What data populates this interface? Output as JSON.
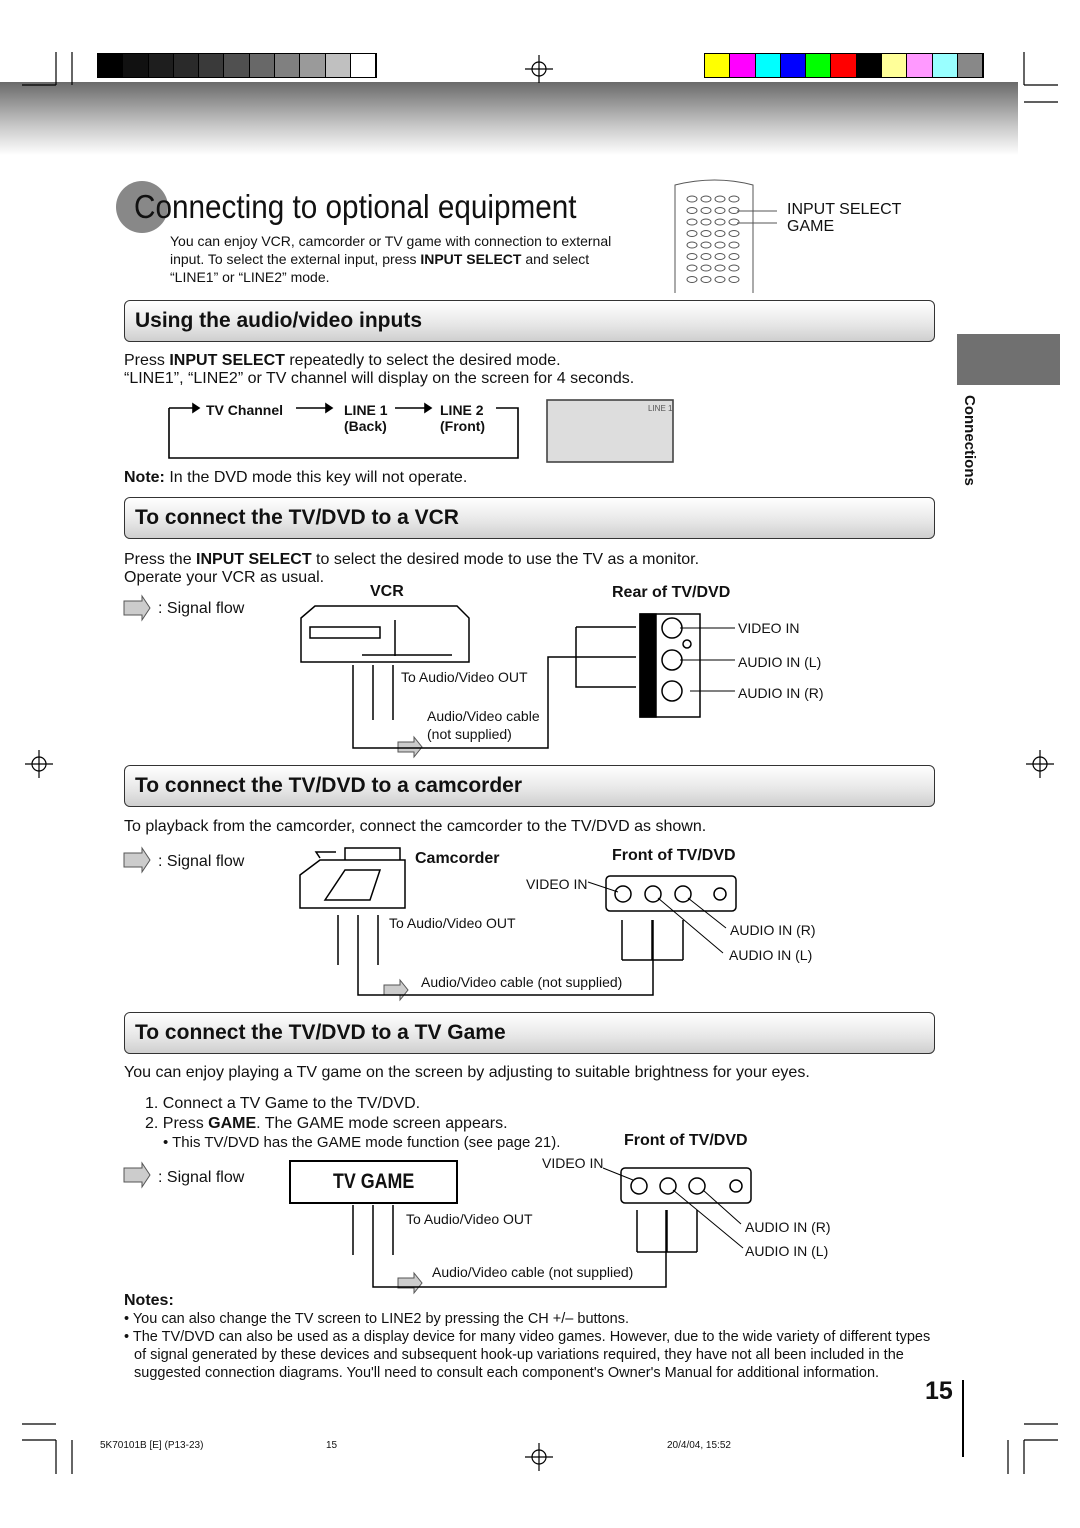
{
  "colors": {
    "gray_bars": [
      "#000",
      "#111",
      "#1e1e1e",
      "#2a2a2a",
      "#3a3a3a",
      "#505050",
      "#686868",
      "#808080",
      "#9a9a9a",
      "#c0c0c0",
      "#fff"
    ],
    "color_bars": [
      "#ffff00",
      "#ff00ff",
      "#00ffff",
      "#0000ff",
      "#00ff00",
      "#ff0000",
      "#000000",
      "#ffff99",
      "#ff99ff",
      "#99ffff",
      "#888888"
    ]
  },
  "title": "Connecting to optional equipment",
  "intro": [
    "You can enjoy VCR, camcorder or TV game with connection to external",
    "input. To select the external input, press ",
    "INPUT SELECT",
    " and select",
    "“LINE1” or “LINE2” mode."
  ],
  "remote": {
    "label1": "INPUT SELECT",
    "label2": "GAME"
  },
  "side_tab": "Connections",
  "s1": {
    "heading": "Using the audio/video inputs",
    "p1a": "Press ",
    "p1b": "INPUT SELECT",
    "p1c": " repeatedly to select the desired mode.",
    "p2": "“LINE1”, “LINE2” or TV channel will display on the screen for 4 seconds.",
    "flow": [
      "TV Channel",
      "LINE 1",
      "(Back)",
      "LINE 2",
      "(Front)"
    ],
    "screen_label": "LINE 1",
    "note_b": "Note:",
    "note": " In the DVD mode this key will not operate."
  },
  "s2": {
    "heading": "To connect the TV/DVD to a VCR",
    "p1a": "Press the ",
    "p1b": "INPUT SELECT",
    "p1c": " to select the desired mode to use the TV as a monitor.",
    "p2": "Operate your VCR as usual.",
    "signal": ": Signal flow",
    "vcr": "VCR",
    "rear": "Rear of TV/DVD",
    "out": "To Audio/Video OUT",
    "cable1": "Audio/Video cable",
    "cable2": "(not supplied)",
    "video_in": "VIDEO IN",
    "audio_l": "AUDIO IN (L)",
    "audio_r": "AUDIO IN (R)"
  },
  "s3": {
    "heading": "To connect the TV/DVD to a camcorder",
    "p1": "To playback from the camcorder, connect the camcorder to the TV/DVD as shown.",
    "signal": ": Signal flow",
    "camcorder": "Camcorder",
    "front": "Front of TV/DVD",
    "video_in": "VIDEO IN",
    "out": "To Audio/Video OUT",
    "audio_r": "AUDIO IN (R)",
    "audio_l": "AUDIO IN (L)",
    "cable": "Audio/Video cable (not supplied)"
  },
  "s4": {
    "heading": "To connect the TV/DVD to a TV Game",
    "p1": "You can enjoy playing a TV game on the screen by adjusting to suitable brightness for your eyes.",
    "step1": "1. Connect a TV Game to the TV/DVD.",
    "step2a": "2. Press ",
    "step2b": "GAME",
    "step2c": ". The GAME mode screen appears.",
    "bullet": "• This TV/DVD has the GAME mode function (see page 21).",
    "front": "Front of TV/DVD",
    "video_in": "VIDEO IN",
    "signal": ": Signal flow",
    "tvgame": "TV GAME",
    "out": "To Audio/Video OUT",
    "audio_r": "AUDIO IN (R)",
    "audio_l": "AUDIO IN (L)",
    "cable": "Audio/Video cable (not supplied)"
  },
  "notes": {
    "title": "Notes:",
    "n1": "• You can also change the TV screen to LINE2 by pressing the CH +/– buttons.",
    "n2a": "• The TV/DVD can also be used as a display device for many video games. However, due to the wide variety of different types",
    "n2b": "of signal generated by these devices and subsequent hook-up variations required, they have not all been included in the",
    "n2c": "suggested connection diagrams. You'll need to consult each component's Owner's Manual for additional information."
  },
  "page_number": "15",
  "footer": {
    "code": "5K70101B [E] (P13-23)",
    "page": "15",
    "date": "20/4/04, 15:52"
  }
}
